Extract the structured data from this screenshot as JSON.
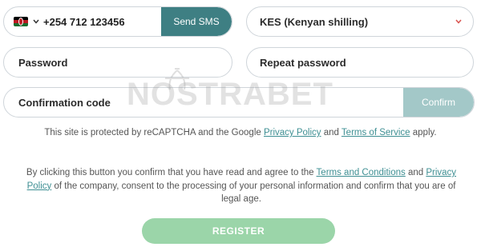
{
  "phone": {
    "country_code": "+254",
    "number": "712 123456",
    "display": "+254 712 123456",
    "send_sms_label": "Send SMS"
  },
  "currency": {
    "selected": "KES (Kenyan shilling)"
  },
  "password": {
    "placeholder": "Password"
  },
  "repeat_password": {
    "placeholder": "Repeat password"
  },
  "confirmation": {
    "placeholder": "Confirmation code",
    "button_label": "Confirm"
  },
  "watermark": {
    "text": "NOSTRABET"
  },
  "recaptcha": {
    "prefix": "This site is protected by reCAPTCHA and the Google ",
    "privacy_link": "Privacy Policy",
    "and": " and ",
    "terms_link": "Terms of Service",
    "suffix": " apply."
  },
  "agreement": {
    "prefix": "By clicking this button you confirm that you have read and agree to the ",
    "terms_link": "Terms and Conditions",
    "and": " and ",
    "privacy_link": "Privacy Policy",
    "suffix": " of the company, consent to the processing of your personal information and confirm that you are of legal age."
  },
  "register": {
    "label": "REGISTER"
  },
  "colors": {
    "accent": "#3e7f83",
    "confirm_disabled": "#a3c8c8",
    "register_disabled": "#9bd5a9",
    "link": "#3e8f93",
    "chevron_red": "#d9534f"
  }
}
